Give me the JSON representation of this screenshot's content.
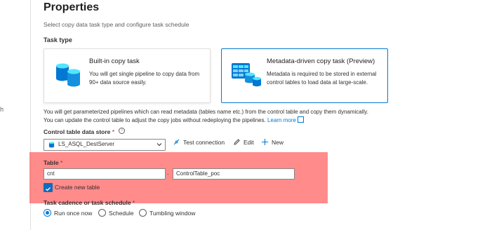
{
  "left": {
    "truncated_char": "h"
  },
  "header": {
    "title": "Properties",
    "subtitle": "Select copy data task type and configure task schedule"
  },
  "task_type": {
    "label": "Task type",
    "cards": [
      {
        "title": "Built-in copy task",
        "desc": "You will get single pipeline to copy data from 90+ data source easily.",
        "selected": false
      },
      {
        "title": "Metadata-driven copy task (Preview)",
        "desc": "Metadata is required to be stored in external control tables to load data at large-scale.",
        "selected": true
      }
    ]
  },
  "info": {
    "text": "You will get parameterized pipelines which can read metadata (tables name etc.) from the control table and copy them dynamically. You can update the control table to adjust the copy jobs without redeploying the pipelines.",
    "link": "Learn more"
  },
  "control_store": {
    "label": "Control table data store",
    "required_mark": "*",
    "info_glyph": "i",
    "selected_value": "LS_ASQL_DestServer",
    "actions": {
      "test_connection": "Test connection",
      "edit": "Edit",
      "new": "New"
    }
  },
  "table": {
    "label": "Table",
    "required_mark": "*",
    "schema_value": "cnt",
    "separator": ".",
    "name_value": "ControlTable_poc",
    "create_new_label": "Create new table",
    "create_new_checked": true
  },
  "cadence": {
    "label": "Task cadence or task schedule",
    "required_mark": "*",
    "options": [
      "Run once now",
      "Schedule",
      "Tumbling window"
    ],
    "selected": "Run once now"
  },
  "colors": {
    "accent": "#0078d4",
    "highlight": "#ff5a5a",
    "required": "#a4262c"
  }
}
